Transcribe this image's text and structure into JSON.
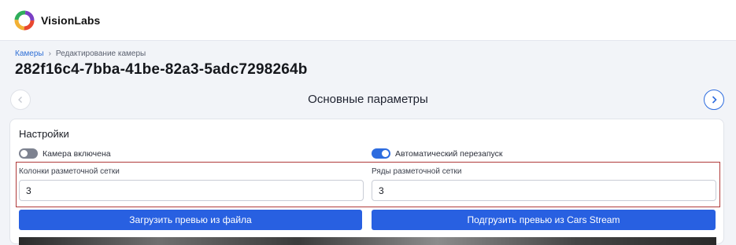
{
  "app": {
    "brand": "VisionLabs"
  },
  "breadcrumb": {
    "root": "Камеры",
    "separator": "›",
    "current": "Редактирование камеры"
  },
  "page": {
    "title": "282f16c4-7bba-41be-82a3-5adc7298264b"
  },
  "section": {
    "title": "Основные параметры"
  },
  "settings": {
    "title": "Настройки",
    "camera_enabled": {
      "label": "Камера включена",
      "on": false
    },
    "auto_restart": {
      "label": "Автоматический перезапуск",
      "on": true
    },
    "grid_columns": {
      "label": "Колонки разметочной сетки",
      "value": "3"
    },
    "grid_rows": {
      "label": "Ряды разметочной сетки",
      "value": "3"
    },
    "upload_preview_button": "Загрузить превью из файла",
    "fetch_preview_button": "Подгрузить превью из Cars Stream"
  },
  "colors": {
    "accent": "#2860e1",
    "highlight_border": "#b03a3a",
    "toggle_off": "#7d8290"
  },
  "icons": {
    "logo": "visionlabs-logo-icon",
    "prev": "chevron-left-icon",
    "next": "chevron-right-icon"
  }
}
